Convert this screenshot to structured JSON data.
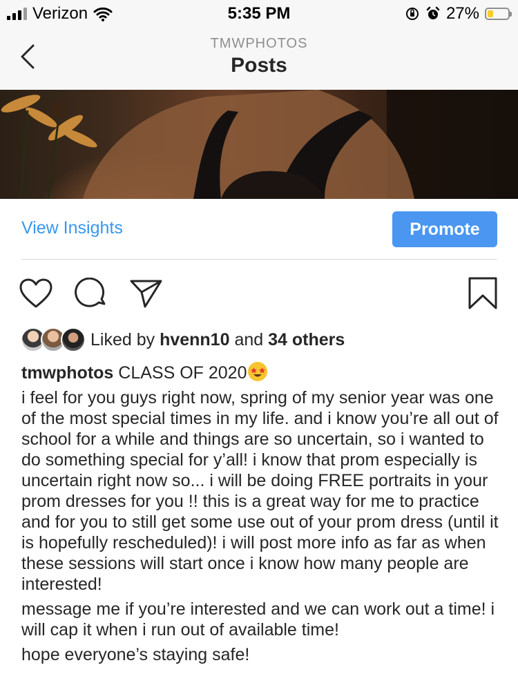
{
  "status_bar": {
    "carrier": "Verizon",
    "time": "5:35 PM",
    "battery": "27%",
    "battery_level": 0.27,
    "icons": [
      "signal-icon",
      "wifi-icon",
      "orientation-lock-icon",
      "alarm-icon",
      "battery-icon"
    ]
  },
  "header": {
    "account": "TMWPHOTOS",
    "title": "Posts"
  },
  "post": {
    "view_insights": "View Insights",
    "promote": "Promote",
    "actions": [
      "like-icon",
      "comment-icon",
      "share-icon",
      "bookmark-icon"
    ],
    "liked_prefix": "Liked by ",
    "liked_user": "hvenn10",
    "liked_mid": " and ",
    "liked_others": "34 others",
    "caption_user": "tmwphotos",
    "caption_first": " CLASS OF 2020",
    "caption_emoji": "star-struck-emoji",
    "caption_paragraphs": [
      "i feel for you guys right now, spring of my senior year was one of the most special times in my life. and i know you’re all out of school for a while and things are so uncertain, so i wanted to do something special for y’all! i know that prom especially is uncertain right now so... i will be doing FREE portraits in your prom dresses for you !! this is a great way for me to practice and for you to still get some use out of your prom dress (until it is hopefully rescheduled)! i will post more info as far as when these sessions will start once i know how many people are interested!",
      "message me if you’re interested and we can work out a time! i will cap it when i run out of available time!",
      "hope everyone’s staying safe!"
    ]
  },
  "colors": {
    "link_blue": "#3897f0",
    "button_blue": "#4a96f0",
    "battery_yellow": "#f6cf2a"
  }
}
